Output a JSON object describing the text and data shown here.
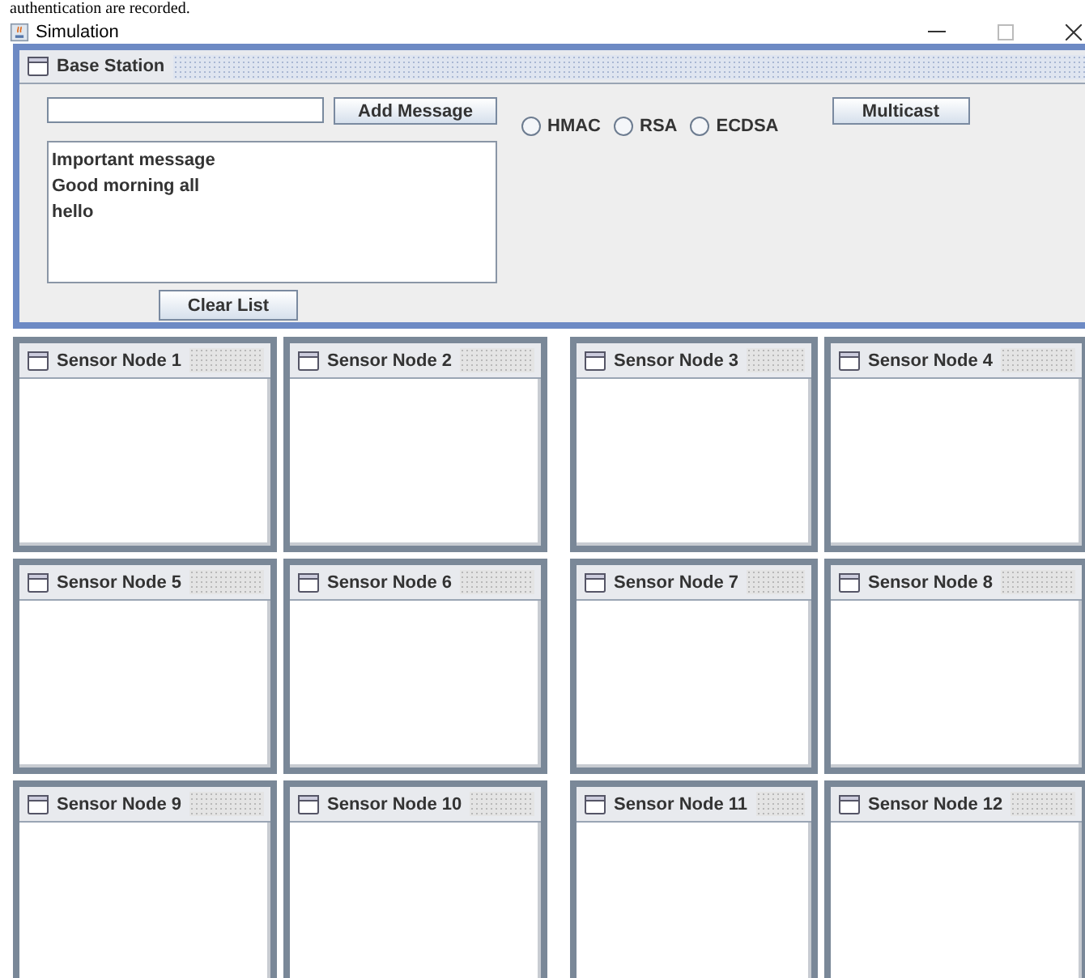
{
  "document_text": "authentication are recorded.",
  "window": {
    "title": "Simulation"
  },
  "base_station": {
    "title": "Base Station",
    "add_button": "Add Message",
    "messages": [
      "Important message",
      "Good morning all",
      "hello"
    ],
    "clear_button": "Clear List",
    "signatures": [
      {
        "label": "HMAC",
        "selected": false
      },
      {
        "label": "RSA",
        "selected": false
      },
      {
        "label": "ECDSA",
        "selected": false
      }
    ],
    "multicast_button": "Multicast"
  },
  "sensor_nodes": [
    {
      "title": "Sensor Node 1"
    },
    {
      "title": "Sensor Node 2"
    },
    {
      "title": "Sensor Node 3"
    },
    {
      "title": "Sensor Node 4"
    },
    {
      "title": "Sensor Node 5"
    },
    {
      "title": "Sensor Node 6"
    },
    {
      "title": "Sensor Node 7"
    },
    {
      "title": "Sensor Node 8"
    },
    {
      "title": "Sensor Node 9"
    },
    {
      "title": "Sensor Node 10"
    },
    {
      "title": "Sensor Node 11"
    },
    {
      "title": "Sensor Node 12"
    }
  ]
}
